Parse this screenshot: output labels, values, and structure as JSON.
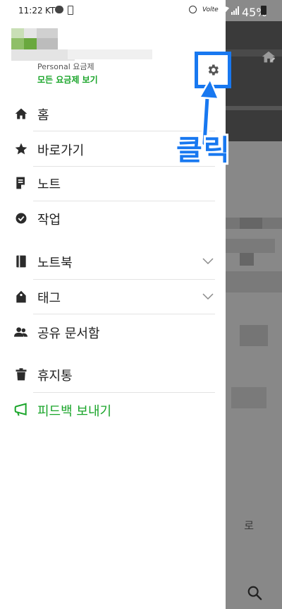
{
  "status_bar": {
    "time": "11:22",
    "carrier": "KT",
    "volte": "Volte",
    "battery_percent": "45%"
  },
  "account": {
    "plan_name": "Personal 요금제",
    "plan_link": "모든 요금제 보기"
  },
  "menu": {
    "items": [
      {
        "label": "홈",
        "icon": "home-icon"
      },
      {
        "label": "바로가기",
        "icon": "star-icon"
      },
      {
        "label": "노트",
        "icon": "note-icon"
      },
      {
        "label": "작업",
        "icon": "check-circle-icon"
      },
      {
        "label": "노트북",
        "icon": "notebook-icon",
        "expandable": true
      },
      {
        "label": "태그",
        "icon": "tag-icon",
        "expandable": true
      },
      {
        "label": "공유 문서함",
        "icon": "shared-users-icon"
      },
      {
        "label": "휴지통",
        "icon": "trash-icon"
      },
      {
        "label": "피드백 보내기",
        "icon": "megaphone-icon",
        "color": "#1aa52a"
      }
    ]
  },
  "annotation": {
    "text": "클릭",
    "color": "#1878f0"
  },
  "background": {
    "partial_text": "로"
  },
  "colors": {
    "accent_green": "#1aa52a",
    "annotation_blue": "#1878f0",
    "overlay": "#888888"
  }
}
